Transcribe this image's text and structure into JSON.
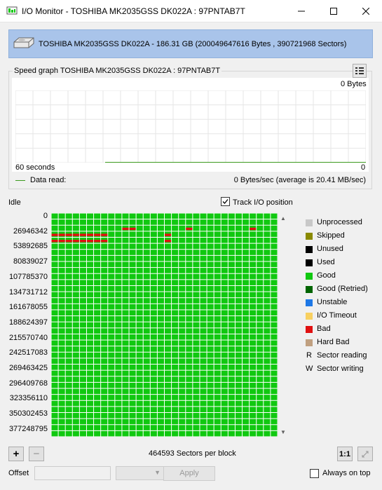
{
  "window": {
    "title": "I/O Monitor - TOSHIBA MK2035GSS DK022A : 97PNTAB7T"
  },
  "drive": {
    "info": "TOSHIBA MK2035GSS DK022A - 186.31 GB (200049647616 Bytes , 390721968 Sectors)"
  },
  "speed_graph": {
    "legend": "Speed graph TOSHIBA MK2035GSS DK022A : 97PNTAB7T",
    "top_value": "0 Bytes",
    "x_left": "60 seconds",
    "x_right": "0",
    "series_label": "Data read:",
    "rate": "0 Bytes/sec (average is 20.41 MB/sec)",
    "line_color": "#3c9a1e"
  },
  "status": "Idle",
  "track_io": {
    "label": "Track I/O position",
    "checked": true
  },
  "map": {
    "row_labels": [
      "0",
      "26946342",
      "53892685",
      "80839027",
      "107785370",
      "134731712",
      "161678055",
      "188624397",
      "215570740",
      "242517083",
      "269463425",
      "296409768",
      "323356110",
      "350302453",
      "377248795"
    ],
    "columns": 32,
    "rows": 37,
    "good_color": "#10c810",
    "bad_color": "#e01010",
    "bad_blocks": [
      {
        "row": 2,
        "col": 10
      },
      {
        "row": 2,
        "col": 11
      },
      {
        "row": 2,
        "col": 19
      },
      {
        "row": 2,
        "col": 28
      },
      {
        "row": 3,
        "col": 0
      },
      {
        "row": 3,
        "col": 1
      },
      {
        "row": 3,
        "col": 2
      },
      {
        "row": 3,
        "col": 3
      },
      {
        "row": 3,
        "col": 4
      },
      {
        "row": 3,
        "col": 5
      },
      {
        "row": 3,
        "col": 6
      },
      {
        "row": 3,
        "col": 7
      },
      {
        "row": 3,
        "col": 16
      },
      {
        "row": 4,
        "col": 0
      },
      {
        "row": 4,
        "col": 1
      },
      {
        "row": 4,
        "col": 2
      },
      {
        "row": 4,
        "col": 3
      },
      {
        "row": 4,
        "col": 4
      },
      {
        "row": 4,
        "col": 5
      },
      {
        "row": 4,
        "col": 6
      },
      {
        "row": 4,
        "col": 7
      },
      {
        "row": 4,
        "col": 16
      }
    ]
  },
  "legend": [
    {
      "label": "Unprocessed",
      "color": "#c8c8c8"
    },
    {
      "label": "Skipped",
      "color": "#8a8a00"
    },
    {
      "label": "Unused",
      "color": "#000000"
    },
    {
      "label": "Used",
      "color": "#000000"
    },
    {
      "label": "Good",
      "color": "#10c810"
    },
    {
      "label": "Good (Retried)",
      "color": "#006400"
    },
    {
      "label": "Unstable",
      "color": "#1e78e6"
    },
    {
      "label": "I/O Timeout",
      "color": "#f8d060"
    },
    {
      "label": "Bad",
      "color": "#e01010"
    },
    {
      "label": "Hard Bad",
      "color": "#c0a080"
    },
    {
      "label": "Sector reading",
      "letter": "R"
    },
    {
      "label": "Sector writing",
      "letter": "W"
    }
  ],
  "footer": {
    "sectors_per_block": "464593 Sectors per block",
    "zoom_label": "1:1",
    "offset_label": "Offset",
    "apply_label": "Apply",
    "always_on_top": {
      "label": "Always on top",
      "checked": false
    }
  }
}
